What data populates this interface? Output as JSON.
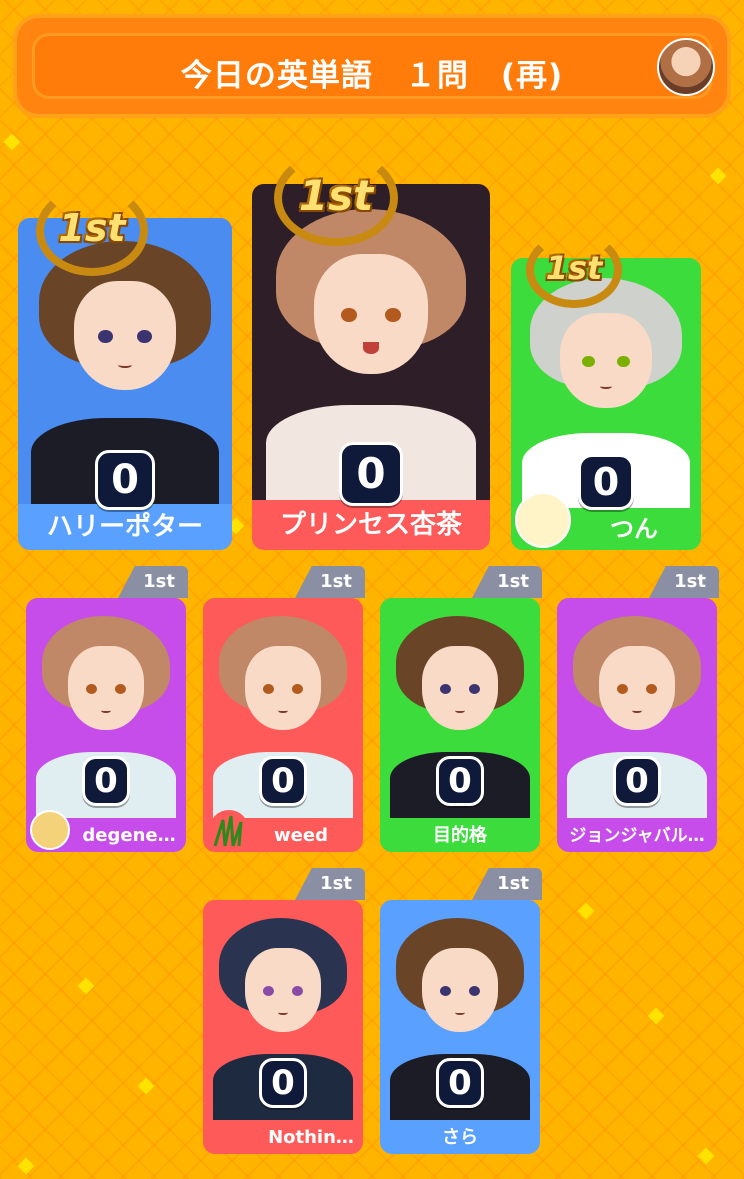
{
  "header": {
    "title": "今日の英単語　１問　(再)"
  },
  "colors": {
    "background": "#ffb400",
    "banner": "#ff8410",
    "card_blue": "#5aa0ff",
    "card_red": "#ff5a5a",
    "card_green": "#3cdc3c",
    "card_purple": "#c64dea",
    "rank_tab": "#8b8fa4",
    "score_bg": "#0f1a3a"
  },
  "top_players": [
    {
      "name": "ハリーポター",
      "score": "0",
      "rank": "1st",
      "color": "#5aa0ff"
    },
    {
      "name": "プリンセス杏茶",
      "score": "0",
      "rank": "1st",
      "color": "#ff5a5a"
    },
    {
      "name": "つん",
      "score": "0",
      "rank": "1st",
      "color": "#3cdc3c"
    }
  ],
  "players": [
    {
      "name": "degene…",
      "score": "0",
      "rank": "1st",
      "color": "#c64dea"
    },
    {
      "name": "weed",
      "score": "0",
      "rank": "1st",
      "color": "#ff5a5a"
    },
    {
      "name": "目的格",
      "score": "0",
      "rank": "1st",
      "color": "#3cdc3c"
    },
    {
      "name": "ジョンジャバル…",
      "score": "0",
      "rank": "1st",
      "color": "#c64dea"
    },
    {
      "name": "Nothin…",
      "score": "0",
      "rank": "1st",
      "color": "#ff5a5a"
    },
    {
      "name": "さら",
      "score": "0",
      "rank": "1st",
      "color": "#5aa0ff"
    }
  ]
}
